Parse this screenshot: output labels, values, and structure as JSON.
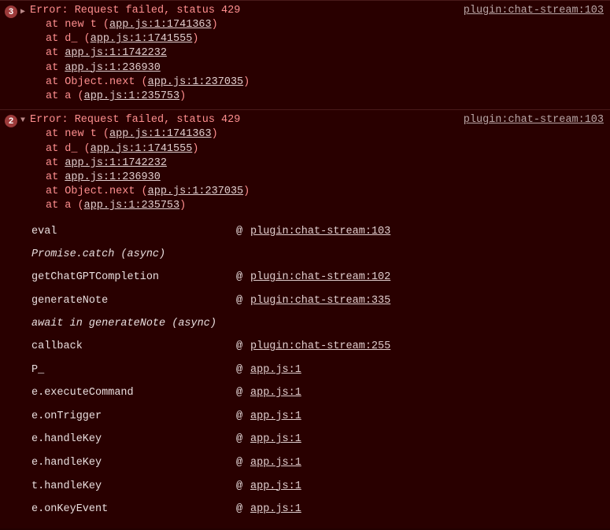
{
  "groups": [
    {
      "count": "3",
      "disclosure": "▶",
      "message": "Error: Request failed, status 429",
      "source": "plugin:chat-stream:103",
      "stack": [
        {
          "prefix": "at new t (",
          "loc": "app.js:1:1741363",
          "suffix": ")"
        },
        {
          "prefix": "at d_ (",
          "loc": "app.js:1:1741555",
          "suffix": ")"
        },
        {
          "prefix": "at ",
          "loc": "app.js:1:1742232",
          "suffix": ""
        },
        {
          "prefix": "at ",
          "loc": "app.js:1:236930",
          "suffix": ""
        },
        {
          "prefix": "at Object.next (",
          "loc": "app.js:1:237035",
          "suffix": ")"
        },
        {
          "prefix": "at a (",
          "loc": "app.js:1:235753",
          "suffix": ")"
        }
      ]
    },
    {
      "count": "2",
      "disclosure": "▼",
      "message": "Error: Request failed, status 429",
      "source": "plugin:chat-stream:103",
      "stack": [
        {
          "prefix": "at new t (",
          "loc": "app.js:1:1741363",
          "suffix": ")"
        },
        {
          "prefix": "at d_ (",
          "loc": "app.js:1:1741555",
          "suffix": ")"
        },
        {
          "prefix": "at ",
          "loc": "app.js:1:1742232",
          "suffix": ""
        },
        {
          "prefix": "at ",
          "loc": "app.js:1:236930",
          "suffix": ""
        },
        {
          "prefix": "at Object.next (",
          "loc": "app.js:1:237035",
          "suffix": ")"
        },
        {
          "prefix": "at a (",
          "loc": "app.js:1:235753",
          "suffix": ")"
        }
      ]
    }
  ],
  "async_trace": [
    {
      "type": "row",
      "fn": "eval",
      "loc": "plugin:chat-stream:103"
    },
    {
      "type": "header",
      "text": "Promise.catch (async)"
    },
    {
      "type": "row",
      "fn": "getChatGPTCompletion",
      "loc": "plugin:chat-stream:102"
    },
    {
      "type": "row",
      "fn": "generateNote",
      "loc": "plugin:chat-stream:335"
    },
    {
      "type": "header",
      "text": "await in generateNote (async)"
    },
    {
      "type": "row",
      "fn": "callback",
      "loc": "plugin:chat-stream:255"
    },
    {
      "type": "row",
      "fn": "P_",
      "loc": "app.js:1"
    },
    {
      "type": "row",
      "fn": "e.executeCommand",
      "loc": "app.js:1"
    },
    {
      "type": "row",
      "fn": "e.onTrigger",
      "loc": "app.js:1"
    },
    {
      "type": "row",
      "fn": "e.handleKey",
      "loc": "app.js:1"
    },
    {
      "type": "row",
      "fn": "e.handleKey",
      "loc": "app.js:1"
    },
    {
      "type": "row",
      "fn": "t.handleKey",
      "loc": "app.js:1"
    },
    {
      "type": "row",
      "fn": "e.onKeyEvent",
      "loc": "app.js:1"
    }
  ],
  "at_glyph": "@"
}
